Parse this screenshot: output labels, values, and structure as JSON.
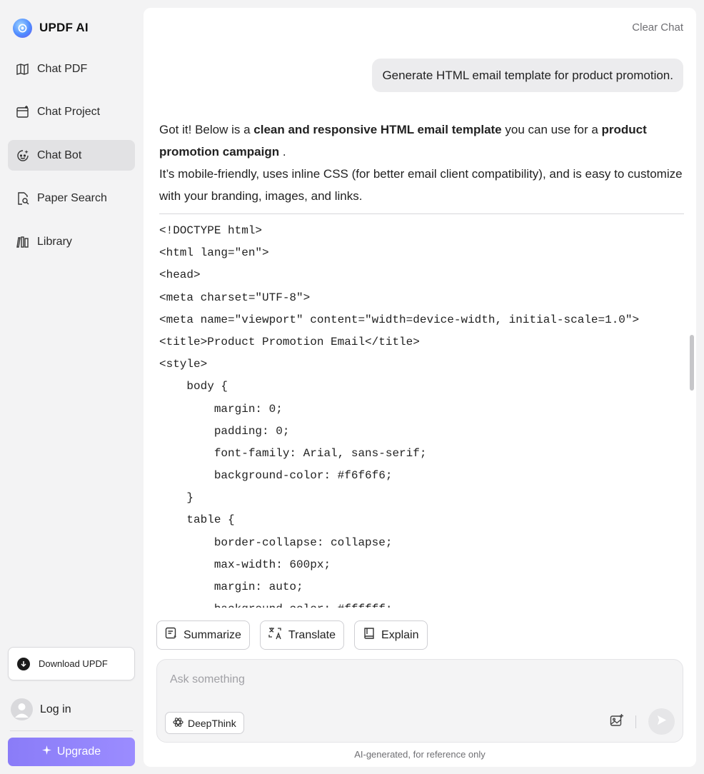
{
  "brand": {
    "name": "UPDF AI"
  },
  "sidebar": {
    "items": [
      {
        "label": "Chat PDF",
        "icon": "book-open-icon"
      },
      {
        "label": "Chat Project",
        "icon": "folder-plus-icon"
      },
      {
        "label": "Chat Bot",
        "icon": "bot-icon",
        "active": true
      },
      {
        "label": "Paper Search",
        "icon": "document-search-icon"
      },
      {
        "label": "Library",
        "icon": "library-icon"
      }
    ],
    "download_label": "Download UPDF",
    "login_label": "Log in",
    "upgrade_label": "Upgrade"
  },
  "header": {
    "clear_chat": "Clear Chat"
  },
  "chat": {
    "user_message": "Generate HTML email template for product promotion.",
    "answer": {
      "p1_a": "Got it! Below is a ",
      "p1_b": "clean and responsive HTML email template",
      "p1_c": " you can use for a ",
      "p1_d": "product promotion campaign",
      "p1_e": " .",
      "p2": "It’s mobile-friendly, uses inline CSS (for better email client compatibility), and is easy to customize with your branding, images, and links."
    },
    "code_lines": [
      "<!DOCTYPE html>",
      "<html lang=\"en\">",
      "<head>",
      "<meta charset=\"UTF-8\">",
      "<meta name=\"viewport\" content=\"width=device-width, initial-scale=1.0\">",
      "<title>Product Promotion Email</title>",
      "<style>",
      "    body {",
      "        margin: 0;",
      "        padding: 0;",
      "        font-family: Arial, sans-serif;",
      "        background-color: #f6f6f6;",
      "    }",
      "    table {",
      "        border-collapse: collapse;",
      "        max-width: 600px;",
      "        margin: auto;",
      "        background-color: #ffffff;"
    ]
  },
  "quick_actions": [
    {
      "label": "Summarize",
      "icon": "summarize-icon"
    },
    {
      "label": "Translate",
      "icon": "translate-icon"
    },
    {
      "label": "Explain",
      "icon": "book-icon"
    }
  ],
  "input": {
    "placeholder": "Ask something",
    "value": "",
    "deepthink_label": "DeepThink"
  },
  "footer_note": "AI-generated, for reference only",
  "colors": {
    "accent": "#8a7cf8",
    "active_nav_bg": "#e2e2e4"
  }
}
